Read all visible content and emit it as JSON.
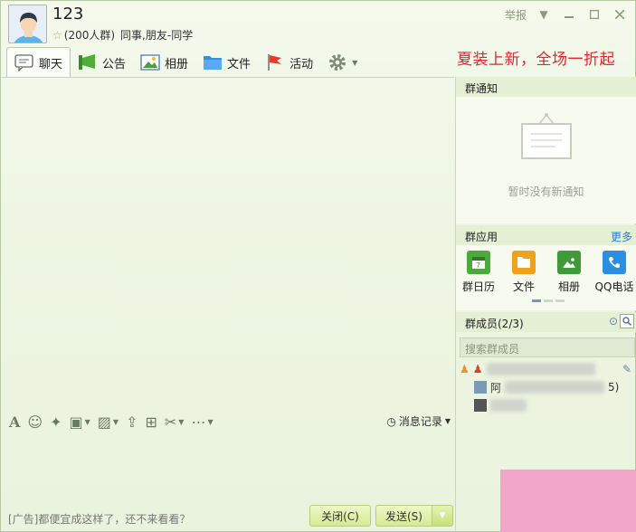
{
  "header": {
    "title": "123",
    "group_size": "(200人群)",
    "group_tags": "同事,朋友-同学",
    "report_label": "举报"
  },
  "tabs": [
    {
      "label": "聊天",
      "icon": "chat-bubble-icon"
    },
    {
      "label": "公告",
      "icon": "megaphone-icon"
    },
    {
      "label": "相册",
      "icon": "photo-album-icon"
    },
    {
      "label": "文件",
      "icon": "folder-icon"
    },
    {
      "label": "活动",
      "icon": "flag-icon"
    }
  ],
  "ad_banner": "夏装上新，全场一折起",
  "input_toolbar": {
    "history_label": "消息记录"
  },
  "bottom_bar": {
    "ad_text": "[广告]都便宜成这样了，还不来看看？",
    "close_label": "关闭(C)",
    "send_label": "发送(S)"
  },
  "right_panel": {
    "notice_title": "群通知",
    "notice_empty": "暂时没有新通知",
    "apps_title": "群应用",
    "more_label": "更多",
    "apps": [
      {
        "label": "群日历",
        "icon": "calendar-icon",
        "color": "#4caa3a"
      },
      {
        "label": "文件",
        "icon": "folder-icon",
        "color": "#f0a21b"
      },
      {
        "label": "相册",
        "icon": "photo-icon",
        "color": "#3f9a3a"
      },
      {
        "label": "QQ电话",
        "icon": "phone-icon",
        "color": "#2a8fe0"
      }
    ],
    "members_title": "群成员(2/3)",
    "member_search_placeholder": "搜索群成员",
    "members": [
      {
        "name_visible": "阿",
        "suffix": "5)"
      }
    ]
  },
  "colors": {
    "ad_red": "#e8232c",
    "link_blue": "#2d7bd2",
    "button_green": "#d4eb92"
  }
}
